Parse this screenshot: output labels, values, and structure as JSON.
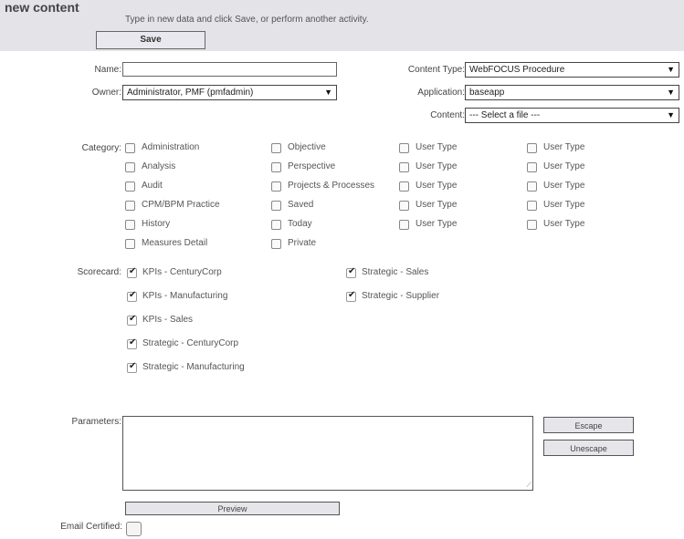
{
  "header": {
    "title": "new content",
    "subtitle": "Type in new data and click Save, or perform another activity.",
    "save_label": "Save"
  },
  "form": {
    "name_label": "Name:",
    "name_value": "",
    "owner_label": "Owner:",
    "owner_value": "Administrator, PMF (pmfadmin)",
    "content_type_label": "Content Type:",
    "content_type_value": "WebFOCUS Procedure",
    "application_label": "Application:",
    "application_value": "baseapp",
    "content_label": "Content:",
    "content_value": "--- Select a file ---"
  },
  "category": {
    "label": "Category:",
    "col1": [
      "Administration",
      "Analysis",
      "Audit",
      "CPM/BPM Practice",
      "History",
      "Measures Detail"
    ],
    "col2": [
      "Objective",
      "Perspective",
      "Projects & Processes",
      "Saved",
      "Today",
      "Private"
    ],
    "col3": [
      "User Type",
      "User Type",
      "User Type",
      "User Type",
      "User Type"
    ],
    "col4": [
      "User Type",
      "User Type",
      "User Type",
      "User Type",
      "User Type"
    ]
  },
  "scorecard": {
    "label": "Scorecard:",
    "left": [
      "KPIs - CenturyCorp",
      "KPIs - Manufacturing",
      "KPIs - Sales",
      "Strategic - CenturyCorp",
      "Strategic - Manufacturing"
    ],
    "right": [
      "Strategic - Sales",
      "Strategic - Supplier"
    ],
    "check_glyph": "✔"
  },
  "parameters": {
    "label": "Parameters:",
    "value": "",
    "escape_label": "Escape",
    "unescape_label": "Unescape",
    "preview_label": "Preview",
    "resize_glyph": "⟋"
  },
  "email": {
    "label": "Email Certified:"
  },
  "icons": {
    "dropdown": "▼"
  }
}
